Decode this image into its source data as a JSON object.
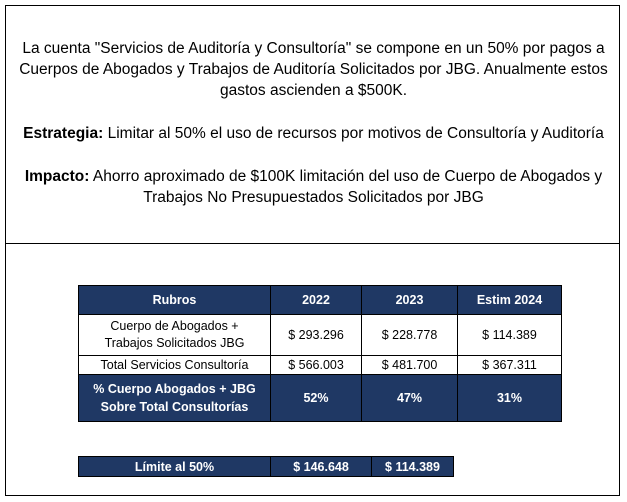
{
  "intro": {
    "line1": "La cuenta \"Servicios de Auditoría y Consultoría\" se compone en un 50% por pagos a",
    "line2": "Cuerpos de Abogados y Trabajos de Auditoría Solicitados por JBG. Anualmente estos",
    "line3": "gastos ascienden a $500K."
  },
  "strategy": {
    "label": "Estrategia:",
    "text": " Limitar al 50% el uso de recursos por motivos de Consultoría y Auditoría"
  },
  "impact": {
    "label": "Impacto:",
    "text1": " Ahorro aproximado de $100K limitación del uso de Cuerpo de Abogados y",
    "text2": "Trabajos No Presupuestados Solicitados por JBG"
  },
  "table": {
    "headers": [
      "Rubros",
      "2022",
      "2023",
      "Estim 2024"
    ],
    "rows": [
      {
        "label1": "Cuerpo de Abogados +",
        "label2": "Trabajos Solicitados JBG",
        "values": [
          "$ 293.296",
          "$ 228.778",
          "$ 114.389"
        ]
      },
      {
        "label": "Total Servicios Consultoría",
        "values": [
          "$ 566.003",
          "$ 481.700",
          "$ 367.311"
        ]
      },
      {
        "label1": "% Cuerpo Abogados + JBG",
        "label2": "Sobre Total Consultorías",
        "values": [
          "52%",
          "47%",
          "31%"
        ]
      }
    ]
  },
  "limit": {
    "label": "Límite al 50%",
    "values": [
      "$ 146.648",
      "$ 114.389"
    ]
  },
  "colors": {
    "header_bg": "#1f3864",
    "header_text": "#ffffff"
  }
}
